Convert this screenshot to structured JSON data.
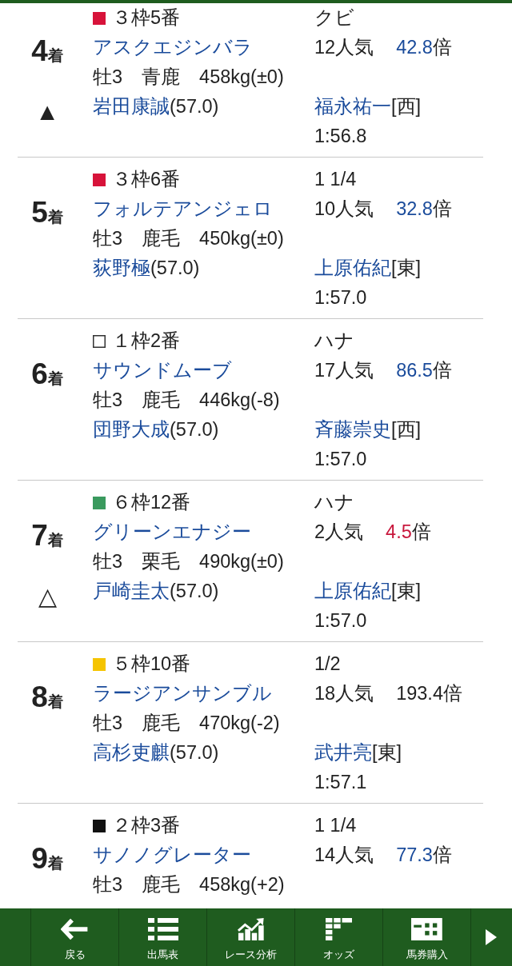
{
  "rows": [
    {
      "place": {
        "number": "4",
        "unit": "着"
      },
      "mark": "▲",
      "frame": {
        "label": "３枠5番",
        "color": "#d7133a"
      },
      "horse": "アスクエジンバラ",
      "profile": "牡3　青鹿　458kg(±0)",
      "jockey": {
        "name": "岩田康誠",
        "weight": "(57.0)"
      },
      "margin": "クビ",
      "popularity": "12人気",
      "odds": {
        "value": "42.8",
        "unit": "倍",
        "color": "#1a4b9b"
      },
      "trainer": {
        "name": "福永祐一",
        "region": "[西]"
      },
      "time": "1:56.8"
    },
    {
      "place": {
        "number": "5",
        "unit": "着"
      },
      "frame": {
        "label": "３枠6番",
        "color": "#d7133a"
      },
      "horse": "フォルテアンジェロ",
      "profile": "牡3　鹿毛　450kg(±0)",
      "jockey": {
        "name": "荻野極",
        "weight": "(57.0)"
      },
      "margin": "1 1/4",
      "popularity": "10人気",
      "odds": {
        "value": "32.8",
        "unit": "倍",
        "color": "#1a4b9b"
      },
      "trainer": {
        "name": "上原佑紀",
        "region": "[東]"
      },
      "time": "1:57.0"
    },
    {
      "place": {
        "number": "6",
        "unit": "着"
      },
      "frame": {
        "label": "１枠2番",
        "color": "#ffffff"
      },
      "horse": "サウンドムーブ",
      "profile": "牡3　鹿毛　446kg(-8)",
      "jockey": {
        "name": "団野大成",
        "weight": "(57.0)"
      },
      "margin": "ハナ",
      "popularity": "17人気",
      "odds": {
        "value": "86.5",
        "unit": "倍",
        "color": "#1a4b9b"
      },
      "trainer": {
        "name": "斉藤崇史",
        "region": "[西]"
      },
      "time": "1:57.0"
    },
    {
      "place": {
        "number": "7",
        "unit": "着"
      },
      "mark": "△",
      "frame": {
        "label": "６枠12番",
        "color": "#3a9a5e"
      },
      "horse": "グリーンエナジー",
      "profile": "牡3　栗毛　490kg(±0)",
      "jockey": {
        "name": "戸崎圭太",
        "weight": "(57.0)"
      },
      "margin": "ハナ",
      "popularity": "2人気",
      "odds": {
        "value": "4.5",
        "unit": "倍",
        "color": "#c8173c"
      },
      "trainer": {
        "name": "上原佑紀",
        "region": "[東]"
      },
      "time": "1:57.0"
    },
    {
      "place": {
        "number": "8",
        "unit": "着"
      },
      "frame": {
        "label": "５枠10番",
        "color": "#f5c400"
      },
      "horse": "ラージアンサンブル",
      "profile": "牡3　鹿毛　470kg(-2)",
      "jockey": {
        "name": "高杉吏麒",
        "weight": "(57.0)"
      },
      "margin": "1/2",
      "popularity": "18人気",
      "odds": {
        "value": "193.4",
        "unit": "倍",
        "color": "#222222"
      },
      "trainer": {
        "name": "武井亮",
        "region": "[東]"
      },
      "time": "1:57.1"
    },
    {
      "place": {
        "number": "9",
        "unit": "着"
      },
      "frame": {
        "label": "２枠3番",
        "color": "#111111"
      },
      "horse": "サノノグレーター",
      "profile": "牡3　鹿毛　458kg(+2)",
      "margin": "1 1/4",
      "popularity": "14人気",
      "odds": {
        "value": "77.3",
        "unit": "倍",
        "color": "#1a4b9b"
      }
    }
  ],
  "nav": {
    "items": [
      {
        "kind": "back",
        "label": "戻る"
      },
      {
        "kind": "entries",
        "label": "出馬表"
      },
      {
        "kind": "analysis",
        "label": "レース分析"
      },
      {
        "kind": "odds",
        "label": "オッズ"
      },
      {
        "kind": "ticket",
        "label": "馬券購入"
      }
    ]
  }
}
